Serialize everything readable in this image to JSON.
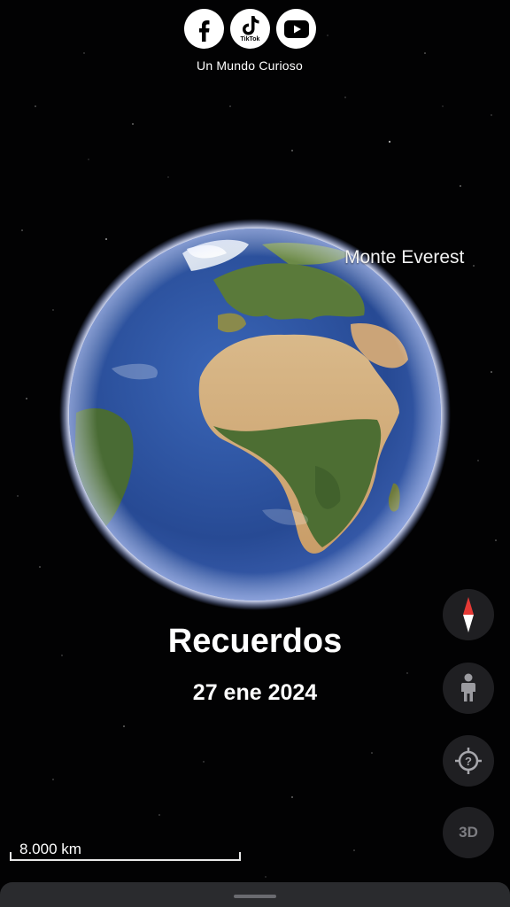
{
  "header": {
    "social": [
      {
        "icon": "facebook-icon"
      },
      {
        "icon": "tiktok-icon",
        "label": "TikTok"
      },
      {
        "icon": "youtube-icon"
      }
    ],
    "channel_name": "Un Mundo Curioso"
  },
  "map": {
    "place_label": "Monte Everest"
  },
  "story": {
    "title": "Recuerdos",
    "date": "27 ene 2024"
  },
  "controls": {
    "compass_icon": "compass-icon",
    "streetview_icon": "pegman-icon",
    "locate_icon": "my-location-icon",
    "toggle_3d_label": "3D"
  },
  "scale": {
    "label": "8.000 km"
  },
  "colors": {
    "background": "#020203",
    "ocean": "#2b4f9c",
    "atmosphere": "#b9c8ff",
    "compass_red": "#e53935",
    "control_bg": "#1f1f22"
  }
}
